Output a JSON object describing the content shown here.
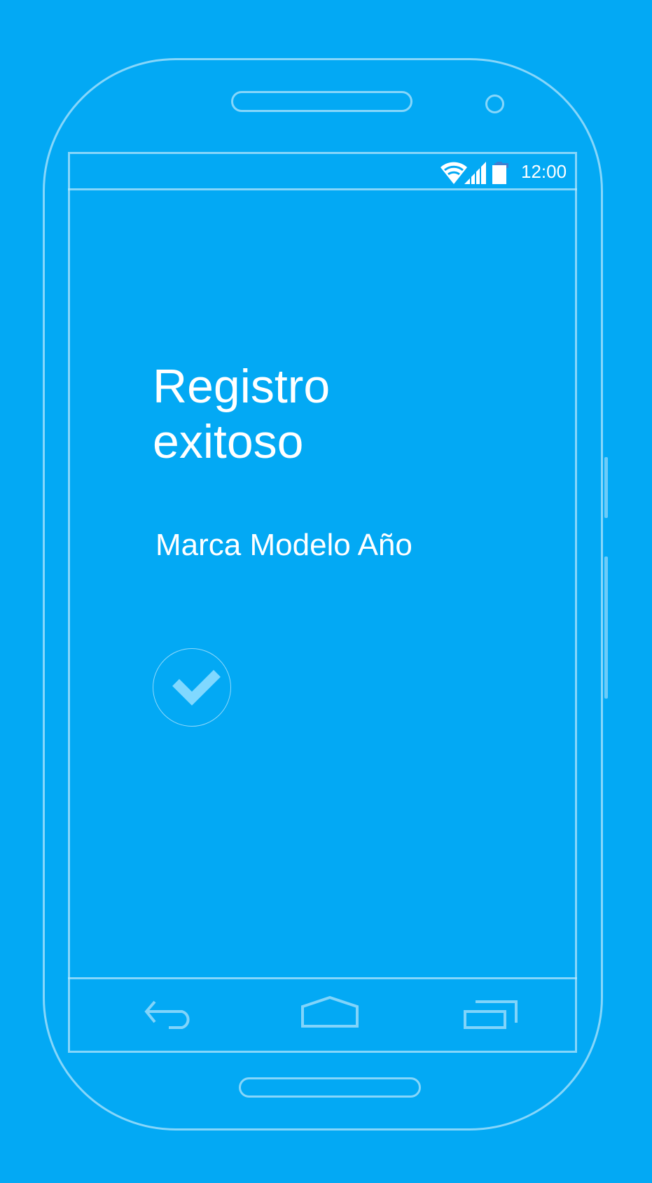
{
  "status_bar": {
    "time": "12:00",
    "icons": [
      "wifi-icon",
      "signal-icon",
      "battery-icon"
    ]
  },
  "main": {
    "title_line1": "Registro",
    "title_line2": "exitoso",
    "subtitle": "Marca Modelo Año",
    "confirm_icon": "check-icon"
  },
  "nav_bar": {
    "icons": [
      "back-icon",
      "home-icon",
      "recents-icon"
    ]
  },
  "colors": {
    "background": "#03a9f4",
    "outline": "#b3e5fc",
    "check": "#80d8ff"
  }
}
